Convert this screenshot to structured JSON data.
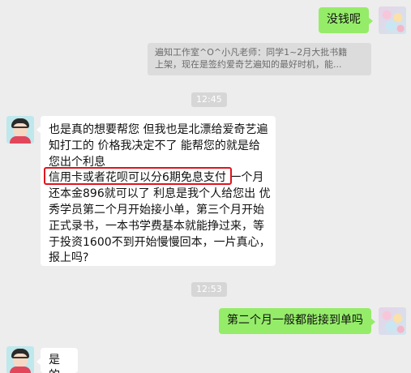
{
  "messages": {
    "m1": {
      "text": "没钱呢"
    },
    "notice": {
      "line1": "遍知工作室^O^小凡老师：同学1~2月大批书籍",
      "line2": "上架，现在是签约爱奇艺遍知的最好时机，能..."
    },
    "time1": "12:45",
    "m2": {
      "lines": [
        "也是真的想要帮您 但我也是北漂给爱奇艺遍",
        "知打工的  价格我决定不了 能帮您的就是给",
        "您出个利息",
        "信用卡或者花呗可以分6期免息支付 一个月",
        "还本金896就可以了 利息是我个人给您出 优",
        "秀学员第二个月开始接小单，第三个月开始",
        "正式录书，一本书学费基本就能挣过来，等",
        "于投资1600不到开始慢慢回本，一片真心，",
        "报上吗?"
      ]
    },
    "time2": "12:53",
    "m3": {
      "text": "第二个月一般都能接到单吗"
    },
    "m4": {
      "text": "是的"
    }
  },
  "colors": {
    "background": "#ededed",
    "bubble_self": "#95ec69",
    "bubble_other": "#ffffff",
    "highlight": "#e0141d"
  }
}
